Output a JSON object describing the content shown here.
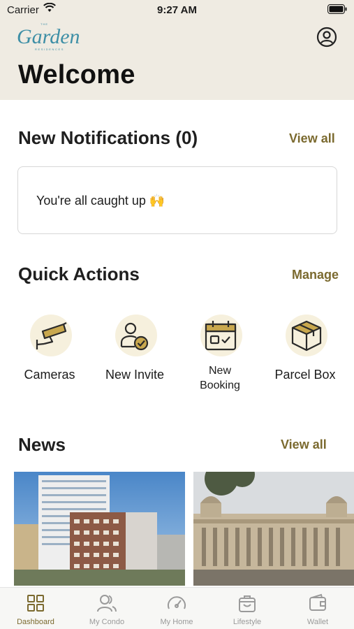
{
  "status_bar": {
    "carrier": "Carrier",
    "time": "9:27 AM"
  },
  "header": {
    "logo_alt": "The Garden Residences",
    "logo_script": "Garden",
    "title": "Welcome"
  },
  "notifications": {
    "title": "New Notifications (0)",
    "view_all": "View all",
    "empty_message": "You're all caught up 🙌"
  },
  "quick_actions": {
    "title": "Quick Actions",
    "manage": "Manage",
    "items": [
      {
        "label": "Cameras",
        "icon": "camera-icon"
      },
      {
        "label": "New Invite",
        "icon": "invite-icon"
      },
      {
        "label": "New Booking",
        "icon": "calendar-icon"
      },
      {
        "label": "Parcel Box",
        "icon": "parcel-icon"
      }
    ]
  },
  "news": {
    "title": "News",
    "view_all": "View all"
  },
  "tabbar": {
    "items": [
      {
        "label": "Dashboard",
        "icon": "grid-icon",
        "active": true
      },
      {
        "label": "My Condo",
        "icon": "people-icon",
        "active": false
      },
      {
        "label": "My Home",
        "icon": "gauge-icon",
        "active": false
      },
      {
        "label": "Lifestyle",
        "icon": "bag-icon",
        "active": false
      },
      {
        "label": "Wallet",
        "icon": "wallet-icon",
        "active": false
      }
    ]
  },
  "colors": {
    "accent": "#7b6a2f",
    "header_bg": "#efebe2",
    "icon_blob": "#f6f0dd"
  }
}
